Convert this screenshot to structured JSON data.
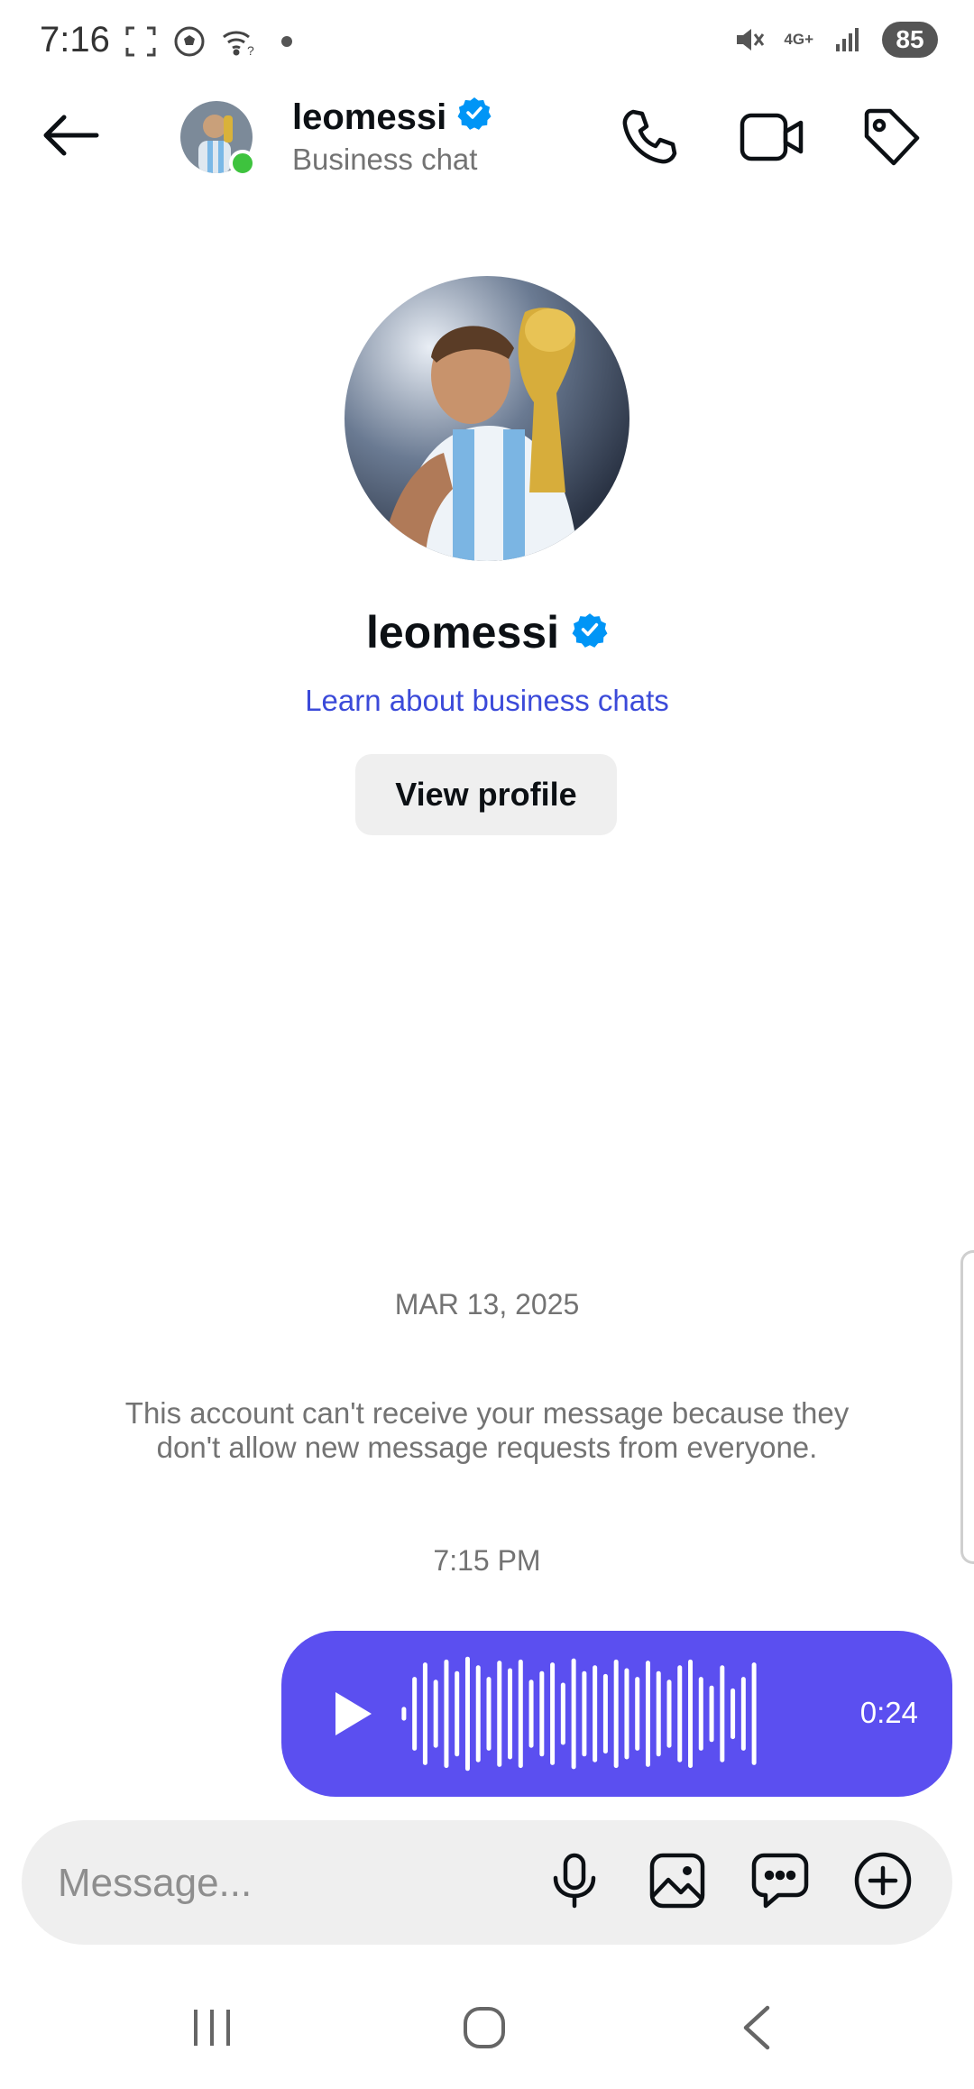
{
  "status_bar": {
    "time": "7:16",
    "network": "4G+",
    "battery": "85"
  },
  "header": {
    "username": "leomessi",
    "subtitle": "Business chat",
    "icons": [
      "back-arrow-icon",
      "phone-icon",
      "video-camera-icon",
      "tag-icon"
    ]
  },
  "profile": {
    "username": "leomessi",
    "learn_link": "Learn about business chats",
    "view_profile_label": "View profile"
  },
  "thread": {
    "date_separator": "MAR 13, 2025",
    "notice_line1": "This account can't receive your message because they",
    "notice_line2": "don't allow new message requests from everyone.",
    "time_separator": "7:15 PM",
    "voice_message": {
      "duration": "0:24"
    }
  },
  "composer": {
    "placeholder": "Message...",
    "icons": [
      "microphone-icon",
      "gallery-icon",
      "sticker-chat-icon",
      "add-icon"
    ]
  },
  "colors": {
    "accent": "#5b4ff0",
    "link": "#3b4ad9",
    "online": "#3ec33e",
    "verified": "#0095f6"
  }
}
